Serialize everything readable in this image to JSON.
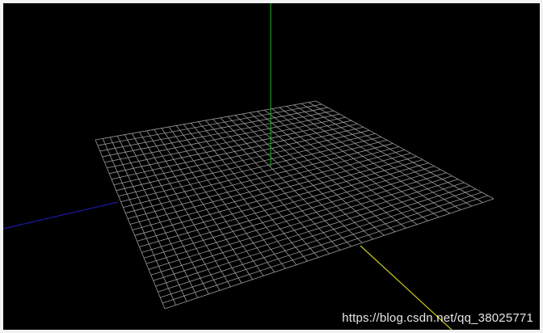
{
  "scene": {
    "background_color": "#000000",
    "frame_color": "#f2f2f2",
    "grid": {
      "divisions": 30,
      "line_color": "#9a9a9a"
    },
    "axes": {
      "x_color": "#1a1aa6",
      "y_color": "#1f9a1f",
      "z_color": "#c8c81e"
    }
  },
  "watermark": {
    "text": "https://blog.csdn.net/qq_38025771",
    "color": "#ffffff"
  }
}
